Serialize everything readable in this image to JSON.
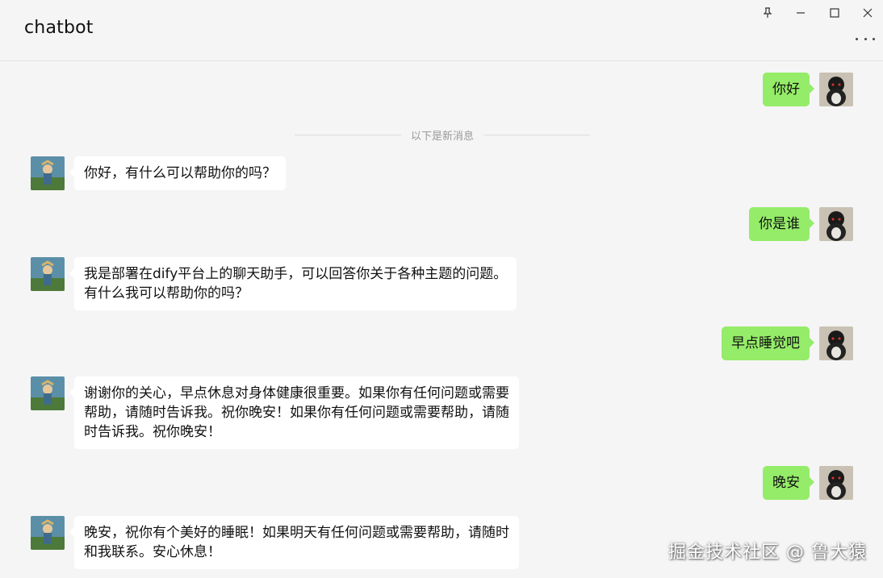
{
  "window": {
    "title": "chatbot",
    "controls": [
      "pin-icon",
      "minimize-icon",
      "maximize-icon",
      "close-icon"
    ],
    "more_icon": "more-options-icon"
  },
  "divider": {
    "text": "以下是新消息"
  },
  "messages": [
    {
      "sender": "user",
      "text": "你好"
    },
    {
      "sender": "bot",
      "text": "你好，有什么可以帮助你的吗？"
    },
    {
      "sender": "user",
      "text": "你是谁"
    },
    {
      "sender": "bot",
      "text": "我是部署在dify平台上的聊天助手，可以回答你关于各种主题的问题。\n有什么我可以帮助你的吗？"
    },
    {
      "sender": "user",
      "text": "早点睡觉吧"
    },
    {
      "sender": "bot",
      "text": "谢谢你的关心，早点休息对身体健康很重要。如果你有任何问题或需要\n帮助，请随时告诉我。祝你晚安！如果你有任何问题或需要帮助，请随\n时告诉我。祝你晚安！"
    },
    {
      "sender": "user",
      "text": "晚安"
    },
    {
      "sender": "bot",
      "text": "晚安，祝你有个美好的睡眠！如果明天有任何问题或需要帮助，请随时\n和我联系。安心休息！"
    }
  ],
  "watermark": "掘金技术社区 @ 鲁大猿",
  "colors": {
    "background": "#f5f5f5",
    "user_bubble": "#95ec69",
    "bot_bubble": "#ffffff",
    "divider_text": "#9a9a9a"
  }
}
